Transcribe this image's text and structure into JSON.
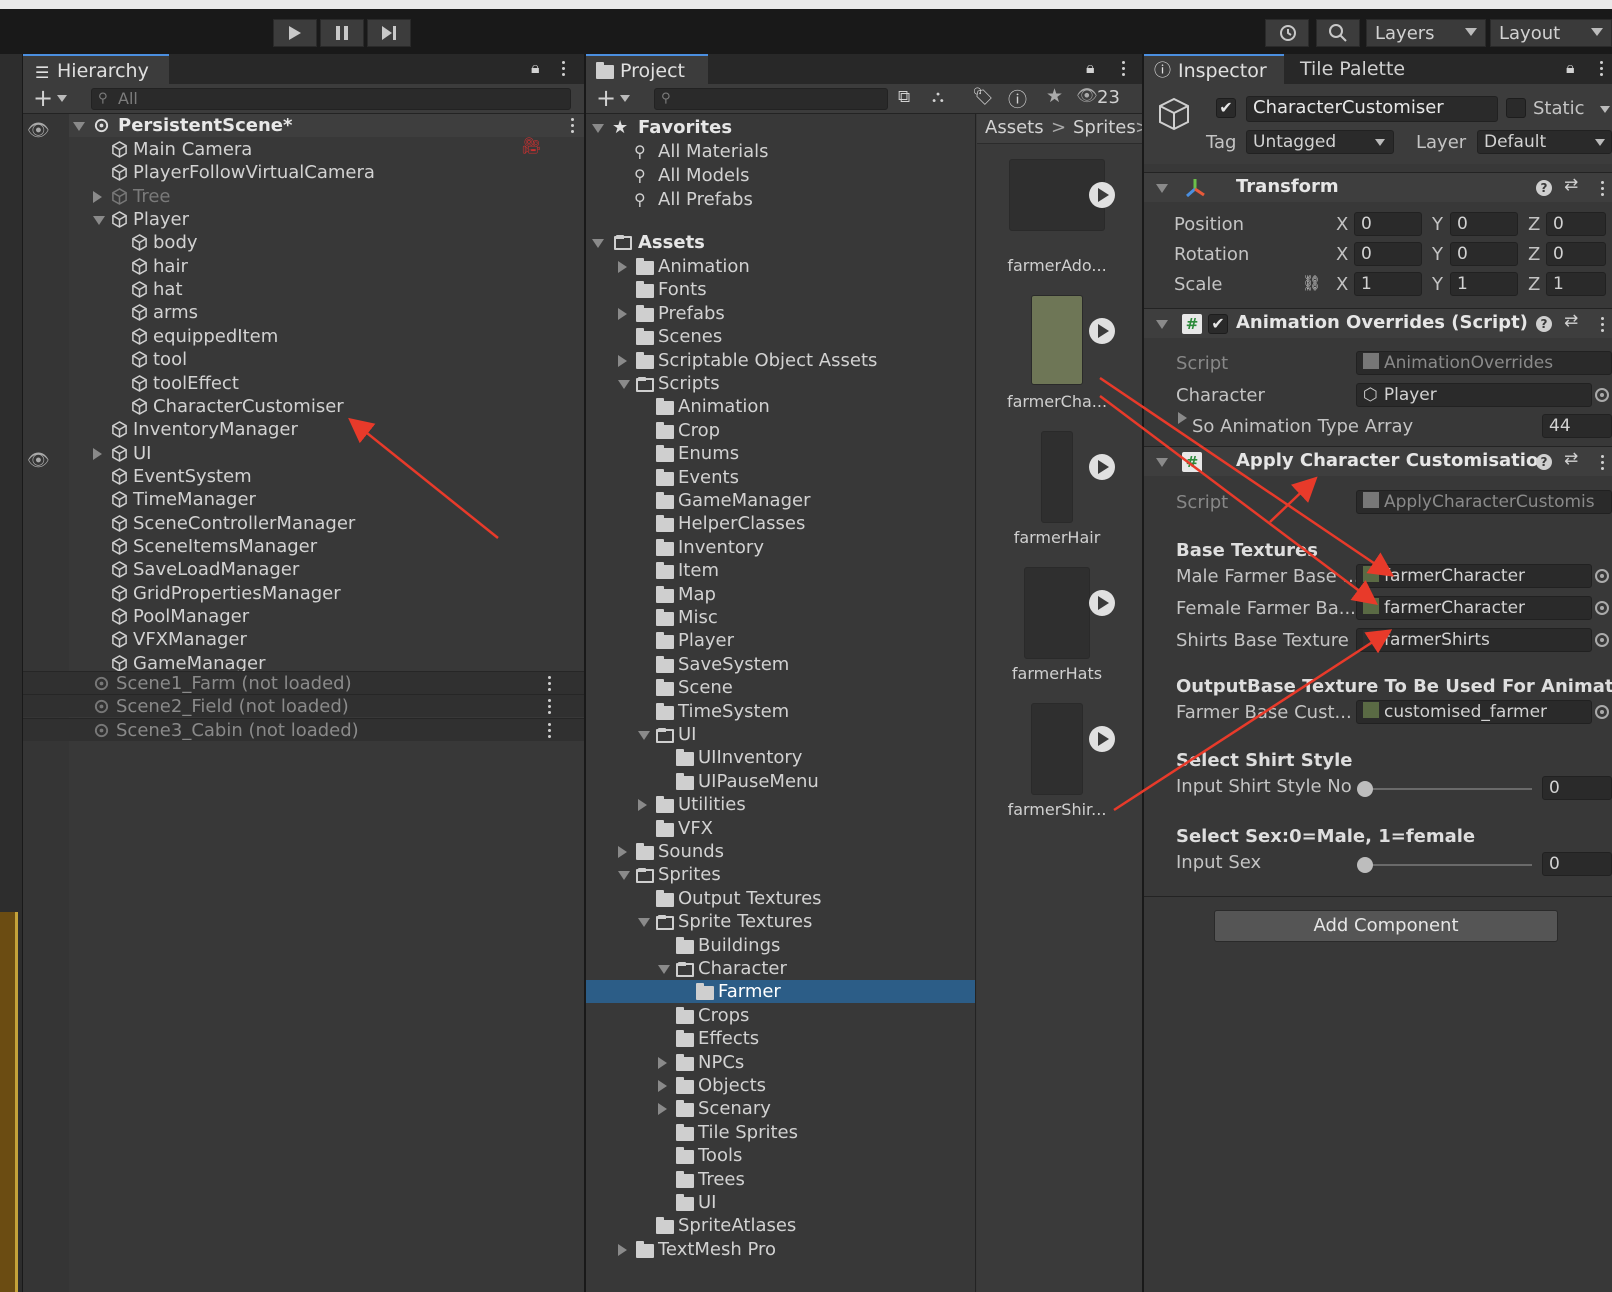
{
  "toolbar": {
    "layers_label": "Layers",
    "layout_label": "Layout",
    "play_icon": "play-icon",
    "pause_icon": "pause-icon",
    "step_icon": "step-icon"
  },
  "hierarchy": {
    "tab_label": "Hierarchy",
    "search_placeholder": "All",
    "scene_name": "PersistentScene*",
    "items": [
      {
        "label": "Main Camera",
        "indent": 1
      },
      {
        "label": "PlayerFollowVirtualCamera",
        "indent": 1
      },
      {
        "label": "Tree",
        "indent": 1,
        "fold": "r",
        "dim": true
      },
      {
        "label": "Player",
        "indent": 1,
        "fold": "d"
      },
      {
        "label": "body",
        "indent": 2
      },
      {
        "label": "hair",
        "indent": 2
      },
      {
        "label": "hat",
        "indent": 2
      },
      {
        "label": "arms",
        "indent": 2
      },
      {
        "label": "equippedItem",
        "indent": 2
      },
      {
        "label": "tool",
        "indent": 2
      },
      {
        "label": "toolEffect",
        "indent": 2
      },
      {
        "label": "CharacterCustomiser",
        "indent": 2
      },
      {
        "label": "InventoryManager",
        "indent": 1
      },
      {
        "label": "UI",
        "indent": 1,
        "fold": "r"
      },
      {
        "label": "EventSystem",
        "indent": 1
      },
      {
        "label": "TimeManager",
        "indent": 1
      },
      {
        "label": "SceneControllerManager",
        "indent": 1
      },
      {
        "label": "SceneItemsManager",
        "indent": 1
      },
      {
        "label": "SaveLoadManager",
        "indent": 1
      },
      {
        "label": "GridPropertiesManager",
        "indent": 1
      },
      {
        "label": "PoolManager",
        "indent": 1
      },
      {
        "label": "VFXManager",
        "indent": 1
      },
      {
        "label": "GameManager",
        "indent": 1
      }
    ],
    "unloaded": [
      "Scene1_Farm (not loaded)",
      "Scene2_Field (not loaded)",
      "Scene3_Cabin (not loaded)"
    ]
  },
  "project": {
    "tab_label": "Project",
    "hidden_count": "23",
    "favorites_label": "Favorites",
    "favorites": [
      "All Materials",
      "All Models",
      "All Prefabs"
    ],
    "assets_label": "Assets",
    "tree": [
      {
        "label": "Animation",
        "indent": 1,
        "fold": "r"
      },
      {
        "label": "Fonts",
        "indent": 1
      },
      {
        "label": "Prefabs",
        "indent": 1,
        "fold": "r"
      },
      {
        "label": "Scenes",
        "indent": 1
      },
      {
        "label": "Scriptable Object Assets",
        "indent": 1,
        "fold": "r"
      },
      {
        "label": "Scripts",
        "indent": 1,
        "fold": "d",
        "open": true
      },
      {
        "label": "Animation",
        "indent": 2
      },
      {
        "label": "Crop",
        "indent": 2
      },
      {
        "label": "Enums",
        "indent": 2
      },
      {
        "label": "Events",
        "indent": 2
      },
      {
        "label": "GameManager",
        "indent": 2
      },
      {
        "label": "HelperClasses",
        "indent": 2
      },
      {
        "label": "Inventory",
        "indent": 2
      },
      {
        "label": "Item",
        "indent": 2
      },
      {
        "label": "Map",
        "indent": 2
      },
      {
        "label": "Misc",
        "indent": 2
      },
      {
        "label": "Player",
        "indent": 2
      },
      {
        "label": "SaveSystem",
        "indent": 2
      },
      {
        "label": "Scene",
        "indent": 2
      },
      {
        "label": "TimeSystem",
        "indent": 2
      },
      {
        "label": "UI",
        "indent": 2,
        "fold": "d",
        "open": true
      },
      {
        "label": "UIInventory",
        "indent": 3
      },
      {
        "label": "UIPauseMenu",
        "indent": 3
      },
      {
        "label": "Utilities",
        "indent": 2,
        "fold": "r"
      },
      {
        "label": "VFX",
        "indent": 2
      },
      {
        "label": "Sounds",
        "indent": 1,
        "fold": "r"
      },
      {
        "label": "Sprites",
        "indent": 1,
        "fold": "d",
        "open": true
      },
      {
        "label": "Output Textures",
        "indent": 2
      },
      {
        "label": "Sprite Textures",
        "indent": 2,
        "fold": "d",
        "open": true
      },
      {
        "label": "Buildings",
        "indent": 3
      },
      {
        "label": "Character",
        "indent": 3,
        "fold": "d",
        "open": true
      },
      {
        "label": "Farmer",
        "indent": 4,
        "selected": true
      },
      {
        "label": "Crops",
        "indent": 3
      },
      {
        "label": "Effects",
        "indent": 3
      },
      {
        "label": "NPCs",
        "indent": 3,
        "fold": "r"
      },
      {
        "label": "Objects",
        "indent": 3,
        "fold": "r"
      },
      {
        "label": "Scenary",
        "indent": 3,
        "fold": "r"
      },
      {
        "label": "Tile Sprites",
        "indent": 3
      },
      {
        "label": "Tools",
        "indent": 3
      },
      {
        "label": "Trees",
        "indent": 3
      },
      {
        "label": "UI",
        "indent": 3
      },
      {
        "label": "SpriteAtlases",
        "indent": 2
      },
      {
        "label": "TextMesh Pro",
        "indent": 1,
        "fold": "r"
      }
    ],
    "breadcrumb": [
      "Assets",
      "Sprites"
    ],
    "thumbnails": [
      "farmerAdo...",
      "farmerCha...",
      "farmerHair",
      "farmerHats",
      "farmerShir..."
    ]
  },
  "inspector": {
    "tab_label": "Inspector",
    "tab2_label": "Tile Palette",
    "object_name": "CharacterCustomiser",
    "static_label": "Static",
    "tag_label": "Tag",
    "tag_value": "Untagged",
    "layer_label": "Layer",
    "layer_value": "Default",
    "transform": {
      "title": "Transform",
      "position_label": "Position",
      "rotation_label": "Rotation",
      "scale_label": "Scale",
      "position": [
        "0",
        "0",
        "0"
      ],
      "rotation": [
        "0",
        "0",
        "0"
      ],
      "scale": [
        "1",
        "1",
        "1"
      ],
      "x": "X",
      "y": "Y",
      "z": "Z"
    },
    "anim_overrides": {
      "title": "Animation Overrides (Script)",
      "script_label": "Script",
      "script_value": "AnimationOverrides",
      "character_label": "Character",
      "character_value": "Player",
      "array_label": "So Animation Type Array",
      "array_value": "44"
    },
    "apply_custom": {
      "title": "Apply Character Customisation",
      "script_label": "Script",
      "script_value": "ApplyCharacterCustomis",
      "base_header": "Base Textures",
      "male_label": "Male Farmer Base ...",
      "male_value": "farmerCharacter",
      "female_label": "Female Farmer Ba...",
      "female_value": "farmerCharacter",
      "shirts_label": "Shirts Base Texture",
      "shirts_value": "farmerShirts",
      "output_header": "OutputBase Texture To Be Used For Animation",
      "farmer_label": "Farmer Base Cust...",
      "farmer_value": "customised_farmer",
      "shirt_header": "Select Shirt Style",
      "shirt_input_label": "Input Shirt Style No",
      "shirt_input_value": "0",
      "sex_header": "Select Sex:0=Male, 1=female",
      "sex_input_label": "Input Sex",
      "sex_input_value": "0"
    },
    "add_component": "Add Component"
  },
  "colors": {
    "selection": "#2c5d87",
    "annotation_arrow": "#e83a2a",
    "accent": "#4b8fe0"
  }
}
